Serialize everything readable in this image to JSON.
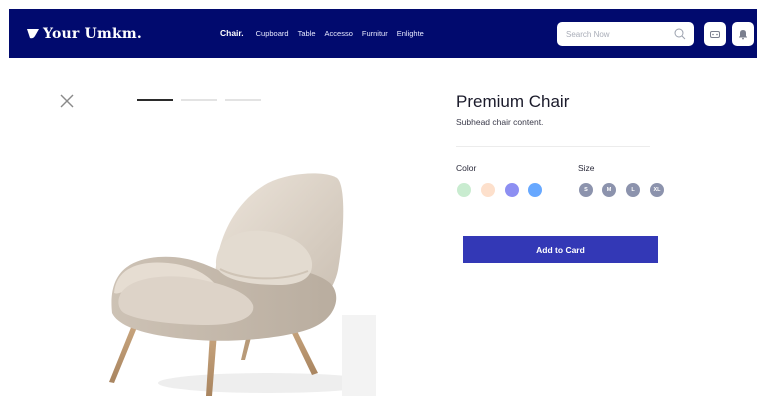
{
  "brand": {
    "name": "Your Umkm."
  },
  "nav": {
    "items": [
      {
        "label": "Chair."
      },
      {
        "label": "Cupboard"
      },
      {
        "label": "Table"
      },
      {
        "label": "Accesso"
      },
      {
        "label": "Furnitur"
      },
      {
        "label": "Enlighte"
      }
    ],
    "active_index": 0
  },
  "search": {
    "placeholder": "Search Now",
    "value": ""
  },
  "header_icons": [
    "search-icon",
    "cart-icon",
    "bell-icon"
  ],
  "slider": {
    "total": 3,
    "active": 1
  },
  "product": {
    "title": "Premium Chair",
    "subhead": "Subhead chair content.",
    "color_label": "Color",
    "size_label": "Size",
    "colors": [
      "#c9ecd0",
      "#fde0cc",
      "#8d8ff2",
      "#67a8ff"
    ],
    "sizes": [
      "S",
      "M",
      "L",
      "XL"
    ],
    "add_button": "Add to Card"
  },
  "theme": {
    "header_bg": "#010a6e",
    "button_bg": "#3338b6",
    "size_dot_bg": "#8c93ad"
  }
}
